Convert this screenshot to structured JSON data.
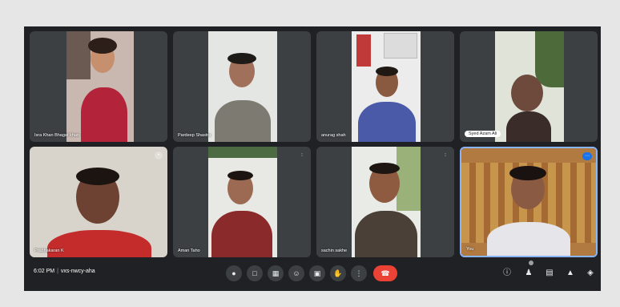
{
  "participants": [
    {
      "name": "Isra Khan Bhagat khan",
      "style": "plain"
    },
    {
      "name": "Pardeep Shastra",
      "style": "plain"
    },
    {
      "name": "anurag shah",
      "style": "plain"
    },
    {
      "name": "Syed Azam Ali",
      "style": "pill"
    },
    {
      "name": "Prabhakaran K",
      "style": "plain"
    },
    {
      "name": "Aman Taho",
      "style": "plain"
    },
    {
      "name": "sachin sakhe",
      "style": "plain"
    },
    {
      "name": "You",
      "style": "plain"
    }
  ],
  "bottom_bar": {
    "time": "6:02 PM",
    "separator": "|",
    "meeting_code": "vxs-nwcy-aha"
  },
  "colors": {
    "background": "#202124",
    "tile": "#3c4043",
    "end_call": "#ea4335",
    "active_border": "#8ab4f8"
  }
}
